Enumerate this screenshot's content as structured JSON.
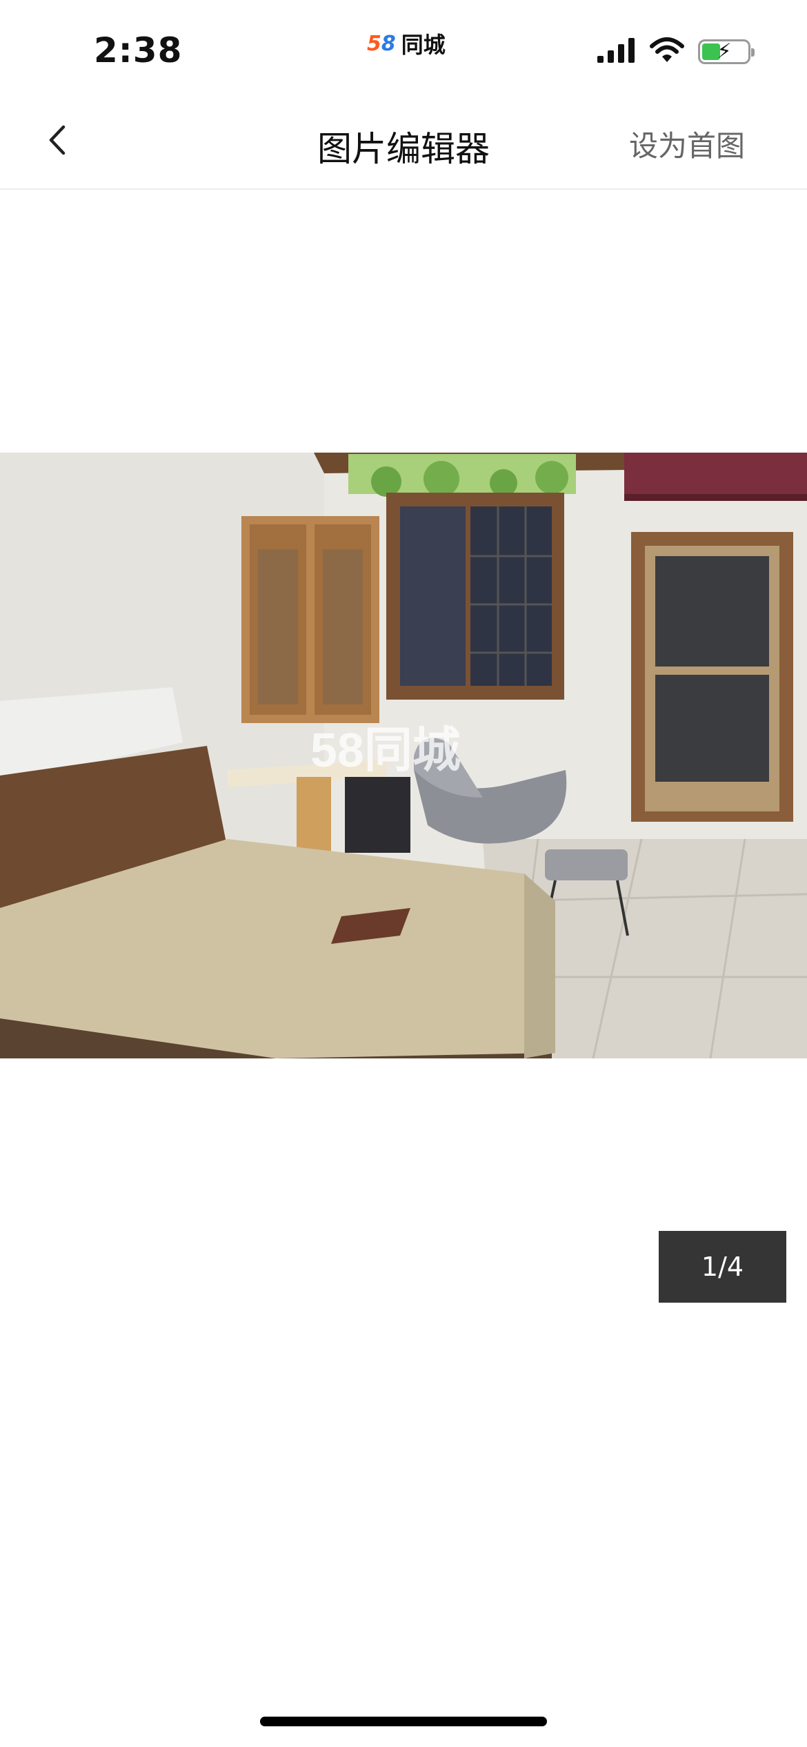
{
  "status_bar": {
    "time": "2:38",
    "carrier_logo": "58",
    "carrier_name": "同城",
    "icons": [
      "cellular-signal-icon",
      "wifi-icon",
      "battery-charging-icon"
    ]
  },
  "nav": {
    "back_icon": "chevron-left-icon",
    "title": "图片编辑器",
    "action": "设为首图"
  },
  "photo": {
    "subject": "bedroom",
    "watermark": "58同城"
  },
  "counter": "1/4",
  "colors": {
    "background": "#ffffff",
    "counter_bg": "#353535",
    "action_text": "#666666",
    "battery": "#3cc24f"
  }
}
